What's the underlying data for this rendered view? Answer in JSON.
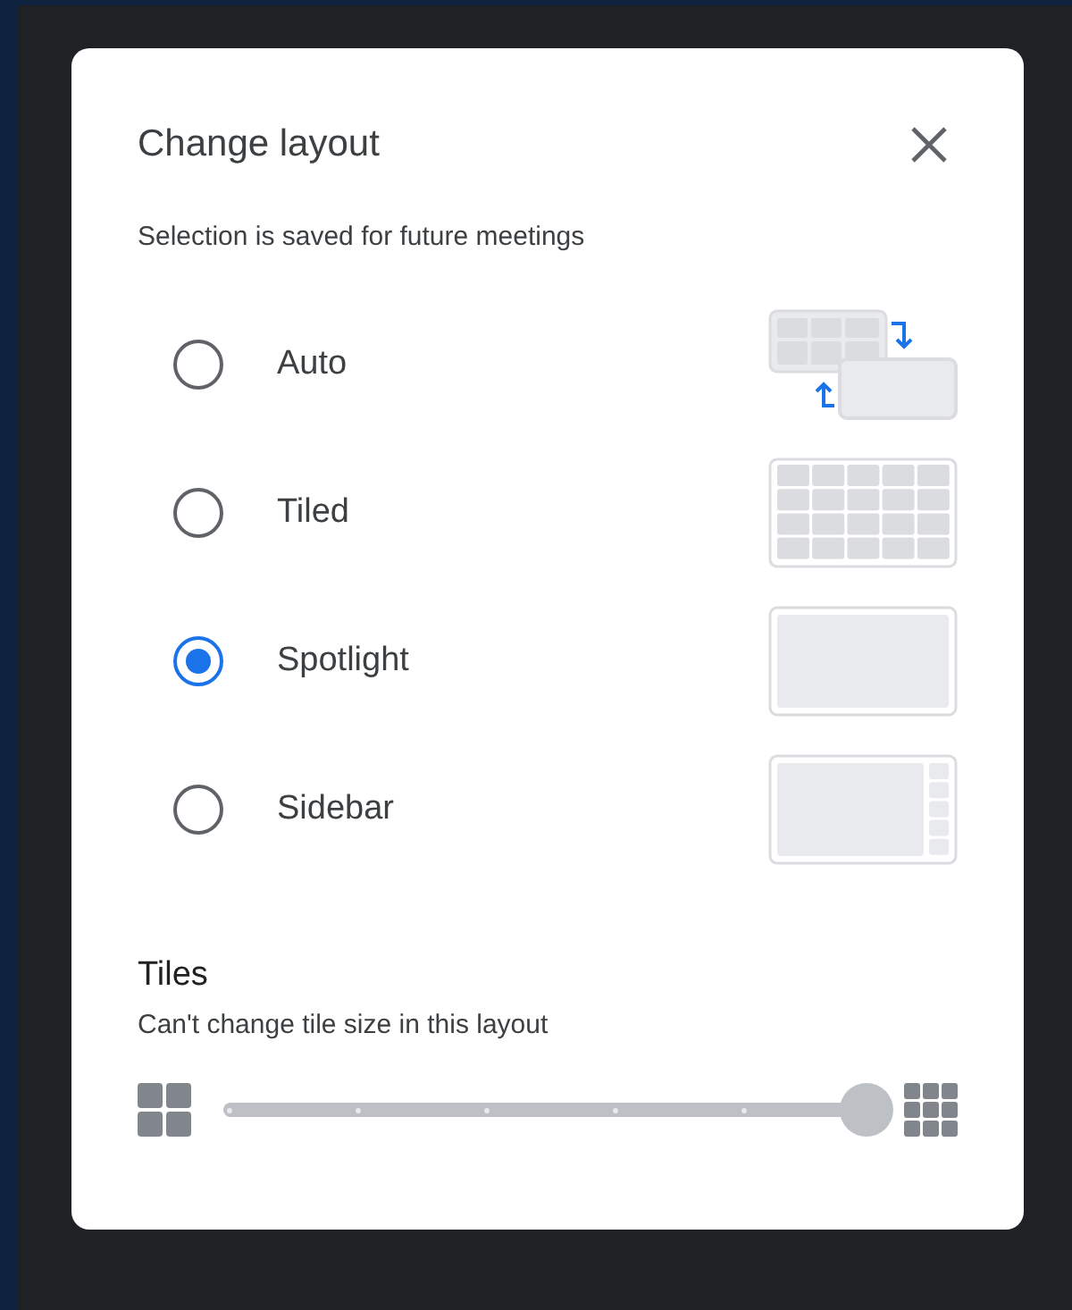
{
  "dialog": {
    "title": "Change layout",
    "subtitle": "Selection is saved for future meetings",
    "options": [
      {
        "label": "Auto",
        "kind": "auto",
        "selected": false
      },
      {
        "label": "Tiled",
        "kind": "tiled",
        "selected": false
      },
      {
        "label": "Spotlight",
        "kind": "spotlight",
        "selected": true
      },
      {
        "label": "Sidebar",
        "kind": "sidebar",
        "selected": false
      }
    ],
    "tiles": {
      "heading": "Tiles",
      "note": "Can't change tile size in this layout",
      "disabled": true,
      "level": 1
    }
  }
}
